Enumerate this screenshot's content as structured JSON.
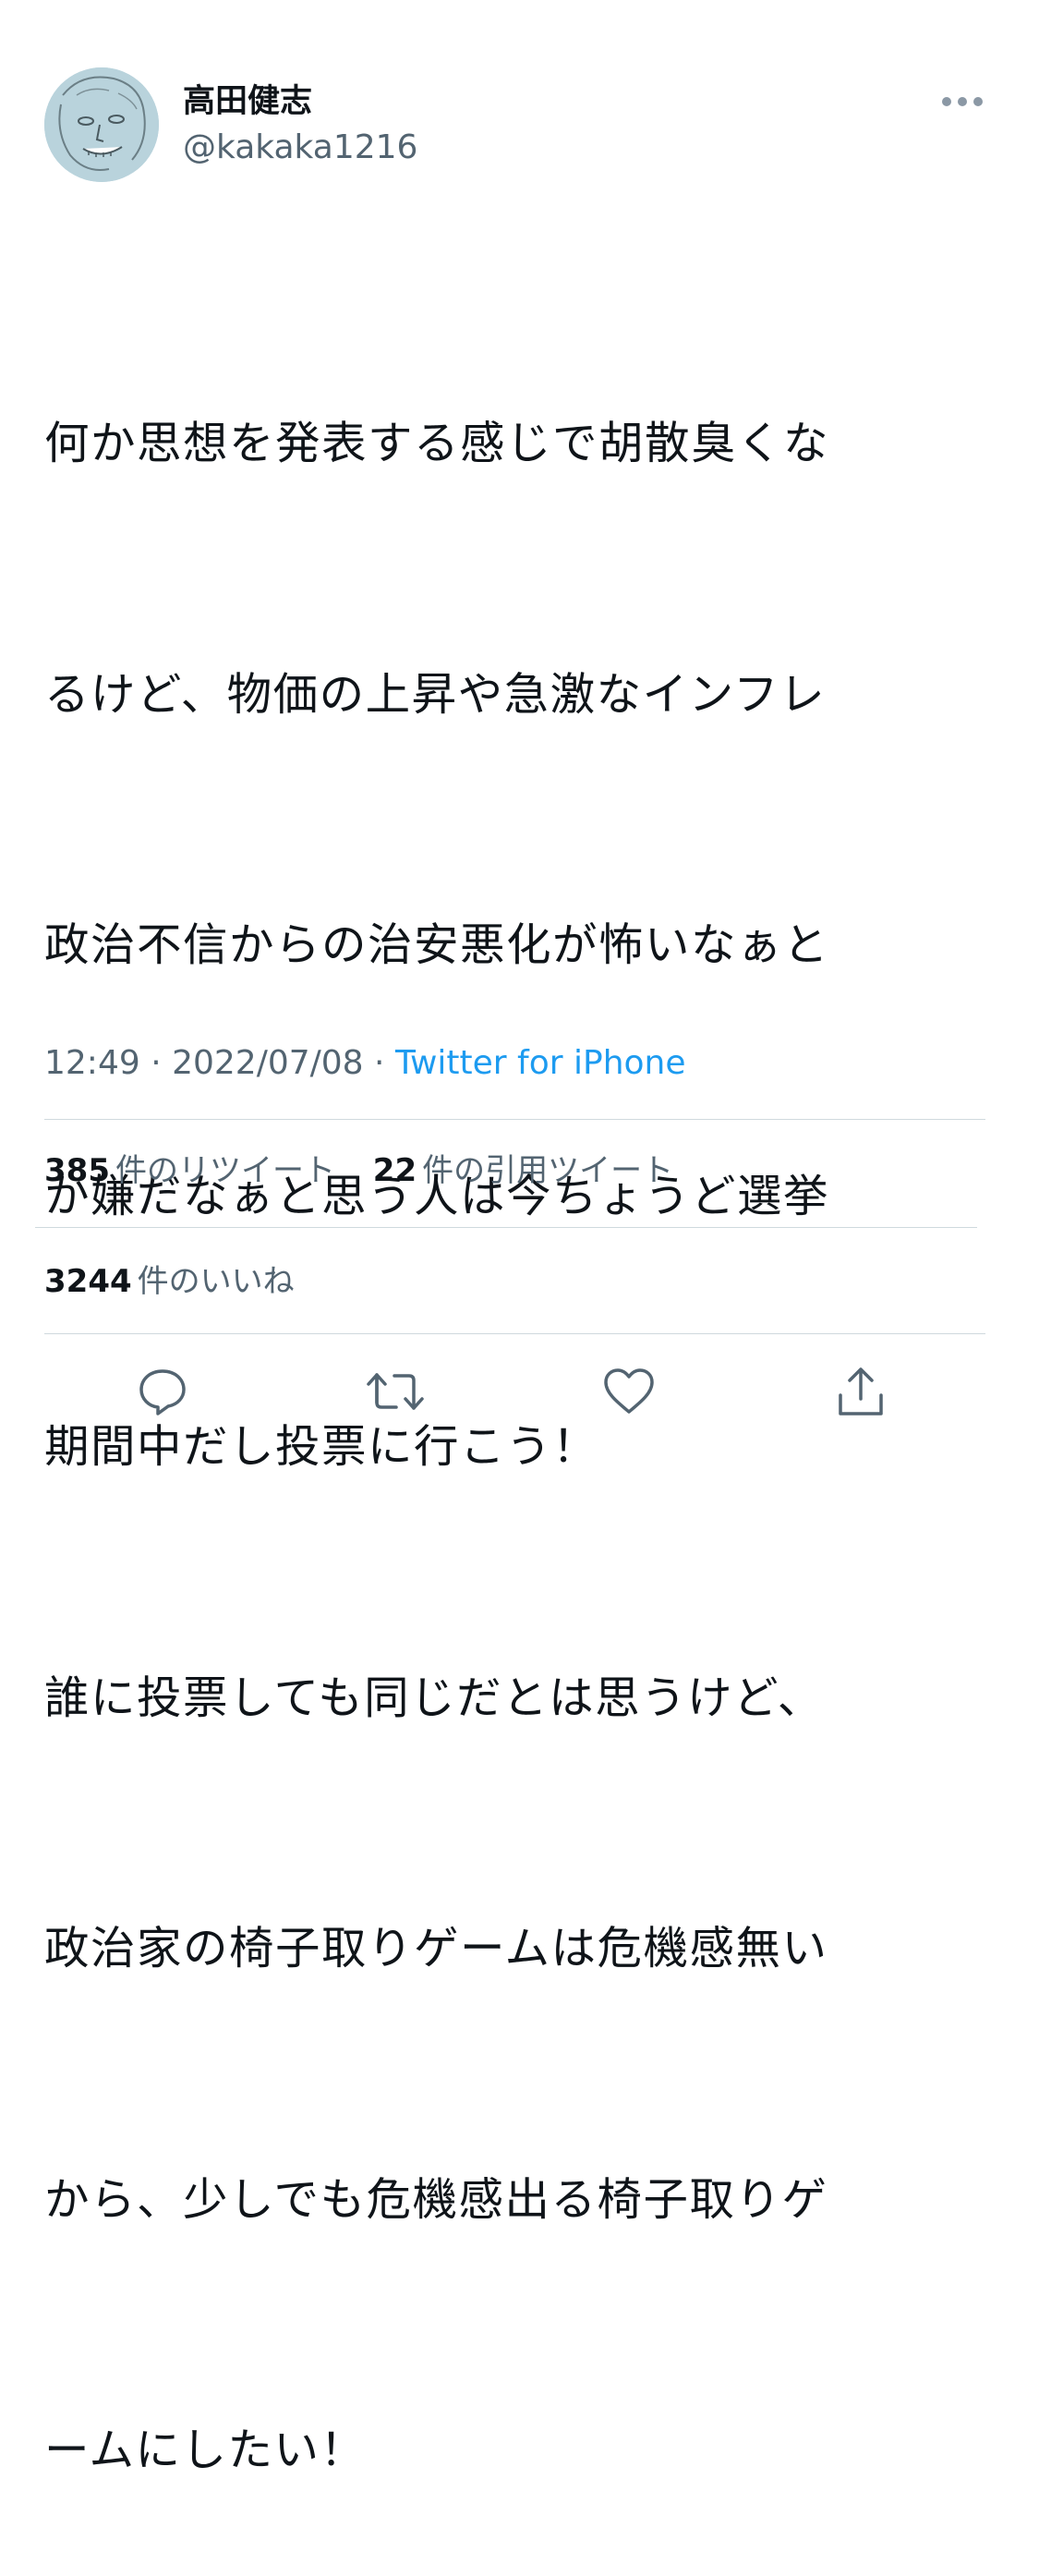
{
  "user": {
    "display_name": "高田健志",
    "handle": "@kakaka1216",
    "avatar_icon": "avatar-sketch"
  },
  "tweet": {
    "lines": [
      "何か思想を発表する感じで胡散臭くな",
      "るけど、物価の上昇や急激なインフレ",
      "政治不信からの治安悪化が怖いなぁと",
      "か嫌だなぁと思う人は今ちょうど選挙",
      "期間中だし投票に行こう！",
      "誰に投票しても同じだとは思うけど、",
      "政治家の椅子取りゲームは危機感無い",
      "から、少しでも危機感出る椅子取りゲ",
      "ームにしたい！"
    ]
  },
  "meta": {
    "time": "12:49",
    "separator": " · ",
    "date": "2022/07/08",
    "source": "Twitter for iPhone"
  },
  "stats": {
    "retweets_count": "385",
    "retweets_label": "件のリツイート",
    "quotes_count": "22",
    "quotes_label": "件の引用ツイート",
    "likes_count": "3244",
    "likes_label": "件のいいね"
  },
  "actions": {
    "reply_icon": "reply-icon",
    "retweet_icon": "retweet-icon",
    "like_icon": "heart-icon",
    "share_icon": "share-icon"
  },
  "colors": {
    "text": "#0f1419",
    "secondary": "#536471",
    "link": "#1d9bf0",
    "divider": "#cfd9de"
  }
}
